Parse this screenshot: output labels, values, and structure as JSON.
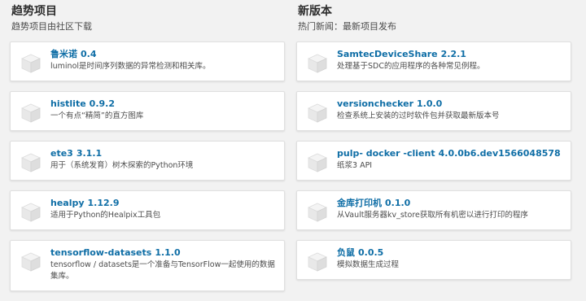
{
  "trending": {
    "title": "趋势项目",
    "subtitle": "趋势项目由社区下载",
    "items": [
      {
        "name": "鲁米诺",
        "version": "0.4",
        "description": "luminol是时间序列数据的异常检测和相关库。"
      },
      {
        "name": "histlite",
        "version": "0.9.2",
        "description": "一个有点“精简”的直方图库"
      },
      {
        "name": "ete3",
        "version": "3.1.1",
        "description": "用于（系统发育）树木探索的Python环境"
      },
      {
        "name": "healpy",
        "version": "1.12.9",
        "description": "适用于Python的Healpix工具包"
      },
      {
        "name": "tensorflow-datasets",
        "version": "1.1.0",
        "description": "tensorflow / datasets是一个准备与TensorFlow一起使用的数据集库。"
      }
    ]
  },
  "new_releases": {
    "title": "新版本",
    "subtitle": "热门新闻：最新项目发布",
    "items": [
      {
        "name": "SamtecDeviceShare",
        "version": "2.2.1",
        "description": "处理基于SDC的应用程序的各种常见例程。"
      },
      {
        "name": "versionchecker",
        "version": "1.0.0",
        "description": "检查系统上安装的过时软件包并获取最新版本号"
      },
      {
        "name": "pulp- docker -client",
        "version": "4.0.0b6.dev1566048578",
        "description": "纸浆3 API"
      },
      {
        "name": "金库打印机",
        "version": "0.1.0",
        "description": "从Vault服务器kv_store获取所有机密以进行打印的程序"
      },
      {
        "name": "负鼠",
        "version": "0.0.5",
        "description": "模拟数据生成过程"
      }
    ]
  },
  "icon": "package-box-icon",
  "colors": {
    "link": "#0f6ea6",
    "background": "#f2f2f2",
    "card": "#ffffff"
  }
}
